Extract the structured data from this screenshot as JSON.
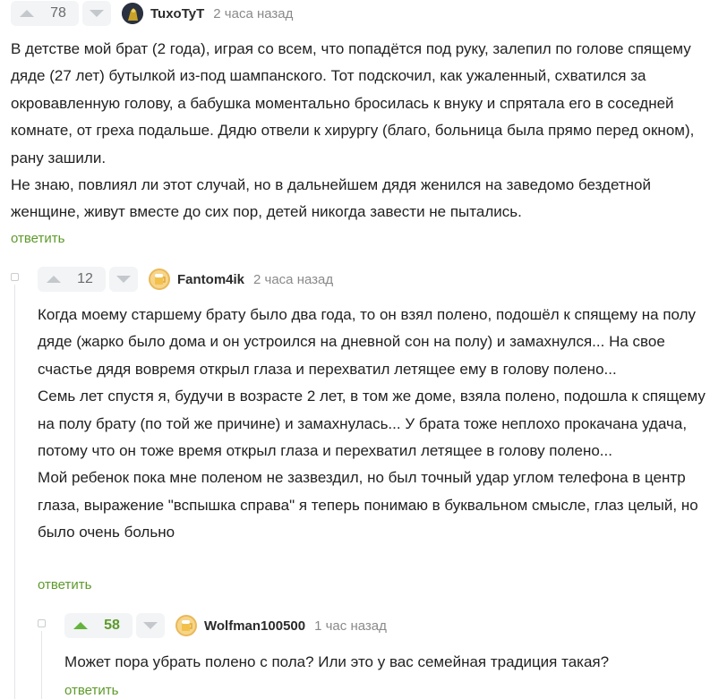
{
  "comments": [
    {
      "rating": "78",
      "username": "TuxoTyT",
      "time": "2 часа назад",
      "paragraphs": [
        "В детстве мой брат (2 года), играя со всем, что попадётся под руку, залепил по голове спящему дяде (27 лет) бутылкой из-под шампанского. Тот подскочил, как ужаленный, схватился за окровавленную голову, а бабушка моментально бросилась к внуку и спрятала его в соседней комнате, от греха подальше. Дядю отвели к хирургу (благо, больница была прямо перед окном), рану зашили.",
        "Не знаю, повлиял ли этот случай, но в дальнейшем дядя женился на заведомо бездетной женщине, живут вместе до сих пор, детей никогда завести не пытались."
      ],
      "reply_label": "ответить"
    },
    {
      "rating": "12",
      "username": "Fantom4ik",
      "time": "2 часа назад",
      "paragraphs": [
        "Когда моему старшему брату было два года, то он взял полено, подошёл к спящему на полу дяде (жарко было дома и он устроился на дневной сон на полу) и замахнулся... На свое счастье дядя вовремя открыл глаза и перехватил летящее ему в голову полено...",
        "Семь лет спустя я, будучи в возрасте 2 лет, в том же доме, взяла полено, подошла к спящему на полу брату (по той же причине) и замахнулась... У брата тоже неплохо прокачана удача, потому что он тоже время открыл глаза и перехватил летящее в голову полено...",
        "Мой ребенок пока мне поленом не зазвездил, но был точный удар углом телефона в центр глаза, выражение \"вспышка справа\" я теперь понимаю в буквальном смысле, глаз целый, но было очень больно"
      ],
      "reply_label": "ответить"
    },
    {
      "rating": "58",
      "username": "Wolfman100500",
      "time": "1 час назад",
      "paragraphs": [
        "Может пора убрать полено с пола? Или это у вас семейная традиция такая?"
      ],
      "reply_label": "ответить"
    }
  ],
  "colors": {
    "accent_green": "#5d9a2a",
    "vote_bg": "#f2f4f5",
    "arrow_grey": "#c4c8cc"
  },
  "icons": [
    "arrow-up-icon",
    "arrow-down-icon",
    "avatar-image",
    "collapse-icon"
  ]
}
